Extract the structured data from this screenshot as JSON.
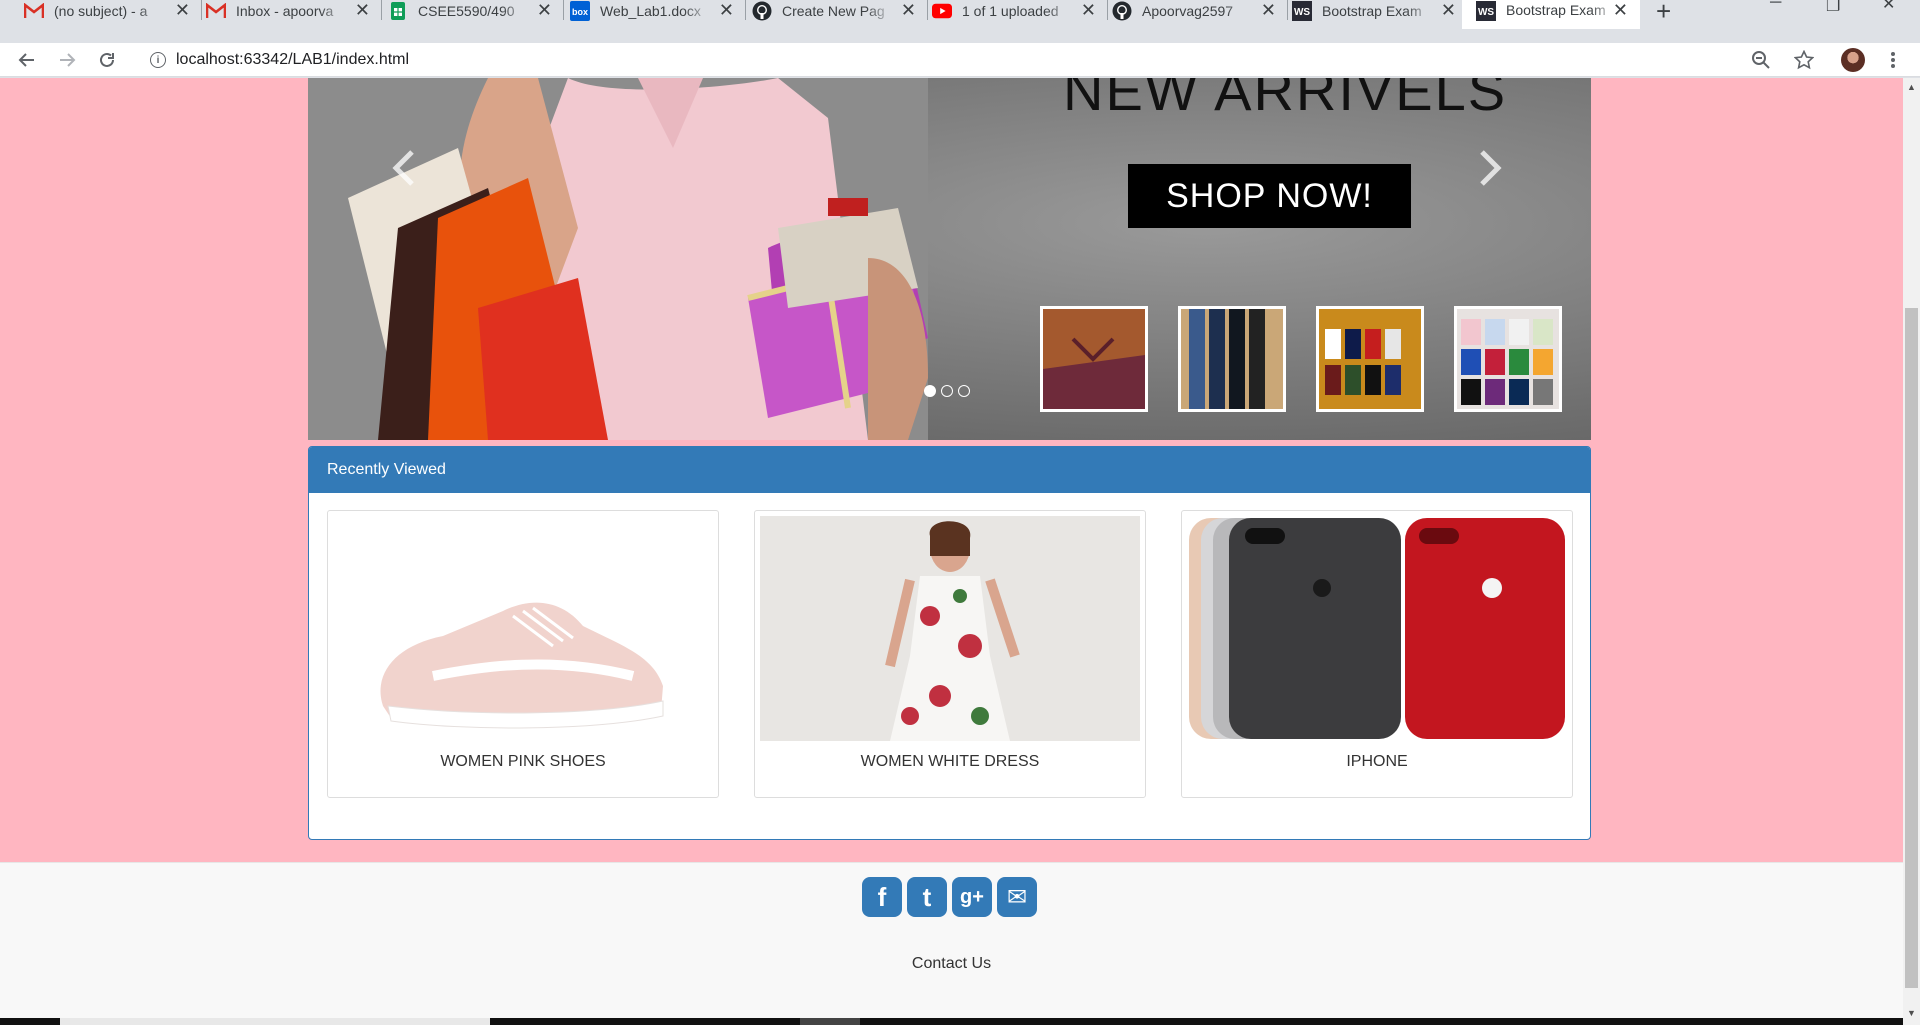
{
  "browser": {
    "tabs": [
      {
        "title": "(no subject) - a",
        "icon": "gmail-icon",
        "color": "#d93025"
      },
      {
        "title": "Inbox - apoorva",
        "icon": "gmail-icon",
        "color": "#d93025"
      },
      {
        "title": "CSEE5590/490",
        "icon": "sheets-icon",
        "color": "#0f9d58"
      },
      {
        "title": "Web_Lab1.docx",
        "icon": "box-icon",
        "color": "#0061d5"
      },
      {
        "title": "Create New Pag",
        "icon": "github-icon",
        "color": "#24292e"
      },
      {
        "title": "1 of 1 uploaded",
        "icon": "youtube-icon",
        "color": "#ff0000"
      },
      {
        "title": "Apoorvag2597",
        "icon": "github-icon",
        "color": "#24292e"
      },
      {
        "title": "Bootstrap Exam",
        "icon": "w3schools-icon",
        "color": "#282a35"
      },
      {
        "title": "Bootstrap Exam",
        "icon": "w3schools-icon",
        "color": "#282a35",
        "active": true
      }
    ],
    "close_glyph": "✕",
    "new_tab_glyph": "+",
    "window_controls": {
      "minimize": "─",
      "restore": "❐",
      "close": "✕"
    },
    "url": {
      "host": "localhost",
      "rest": ":63342/LAB1/index.html"
    },
    "info_glyph": "i"
  },
  "carousel": {
    "headline": "NEW ARRIVELS",
    "cta": "SHOP NOW!",
    "prev_glyph": "‹",
    "next_glyph": "›",
    "active_index": 0
  },
  "recently_viewed": {
    "heading": "Recently Viewed",
    "items": [
      {
        "label": "WOMEN PINK SHOES"
      },
      {
        "label": "WOMEN WHITE DRESS"
      },
      {
        "label": "IPHONE"
      }
    ]
  },
  "footer": {
    "social": [
      {
        "name": "facebook-icon",
        "glyph": "f"
      },
      {
        "name": "twitter-icon",
        "glyph": "t"
      },
      {
        "name": "google-plus-icon",
        "glyph": "g+"
      },
      {
        "name": "email-icon",
        "glyph": "✉"
      }
    ],
    "contact": "Contact Us"
  },
  "colors": {
    "page_bg": "#ffb6c1",
    "panel_primary": "#337ab7",
    "footer_bg": "#f8f8f8"
  }
}
